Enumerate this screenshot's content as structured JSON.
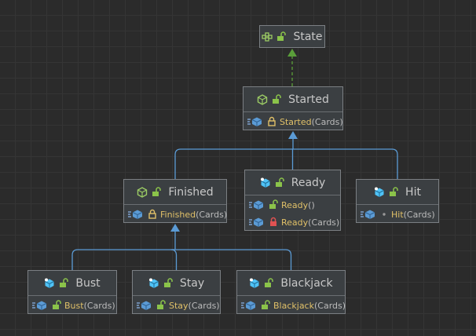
{
  "colors": {
    "background": "#2b2b2b",
    "inheritance_edge": "#5b9bd5",
    "implements_edge": "#5a9e3a",
    "method_name": "#e0c068",
    "class_icon": "#9ccc65",
    "abstract_class_icon": "#4fc3f7",
    "unlock_icon": "#8bc34a",
    "lock_icon": "#e05252",
    "protected_icon": "#e0c068"
  },
  "nodes": [
    {
      "id": "state",
      "name": "State",
      "kind": "interface",
      "icon": "interface-icon",
      "visibility_icon": "unlock-icon",
      "members": []
    },
    {
      "id": "started",
      "name": "Started",
      "kind": "abstract-class",
      "icon": "abstract-class-icon",
      "visibility_icon": "unlock-icon",
      "members": [
        {
          "name": "Started",
          "args": "(Cards)",
          "access_icon": "protected-lock-icon"
        }
      ]
    },
    {
      "id": "finished",
      "name": "Finished",
      "kind": "abstract-class",
      "icon": "abstract-class-icon",
      "visibility_icon": "unlock-icon",
      "members": [
        {
          "name": "Finished",
          "args": "(Cards)",
          "access_icon": "protected-lock-icon"
        }
      ]
    },
    {
      "id": "ready",
      "name": "Ready",
      "kind": "class",
      "icon": "class-icon",
      "visibility_icon": "unlock-icon",
      "members": [
        {
          "name": "Ready",
          "args": "()",
          "access_icon": "unlock-icon"
        },
        {
          "name": "Ready",
          "args": "(Cards)",
          "access_icon": "private-lock-icon"
        }
      ]
    },
    {
      "id": "hit",
      "name": "Hit",
      "kind": "class",
      "icon": "class-icon",
      "visibility_icon": "unlock-icon",
      "members": [
        {
          "name": "Hit",
          "args": "(Cards)",
          "access_icon": "package-dot-icon"
        }
      ]
    },
    {
      "id": "bust",
      "name": "Bust",
      "kind": "class",
      "icon": "class-icon",
      "visibility_icon": "unlock-icon",
      "members": [
        {
          "name": "Bust",
          "args": "(Cards)",
          "access_icon": "unlock-icon"
        }
      ]
    },
    {
      "id": "stay",
      "name": "Stay",
      "kind": "class",
      "icon": "class-icon",
      "visibility_icon": "unlock-icon",
      "members": [
        {
          "name": "Stay",
          "args": "(Cards)",
          "access_icon": "unlock-icon"
        }
      ]
    },
    {
      "id": "blackjack",
      "name": "Blackjack",
      "kind": "class",
      "icon": "class-icon",
      "visibility_icon": "unlock-icon",
      "members": [
        {
          "name": "Blackjack",
          "args": "(Cards)",
          "access_icon": "unlock-icon"
        }
      ]
    }
  ],
  "edges": [
    {
      "from": "started",
      "to": "state",
      "type": "implements"
    },
    {
      "from": "finished",
      "to": "started",
      "type": "extends"
    },
    {
      "from": "ready",
      "to": "started",
      "type": "extends"
    },
    {
      "from": "hit",
      "to": "started",
      "type": "extends"
    },
    {
      "from": "bust",
      "to": "finished",
      "type": "extends"
    },
    {
      "from": "stay",
      "to": "finished",
      "type": "extends"
    },
    {
      "from": "blackjack",
      "to": "finished",
      "type": "extends"
    }
  ]
}
